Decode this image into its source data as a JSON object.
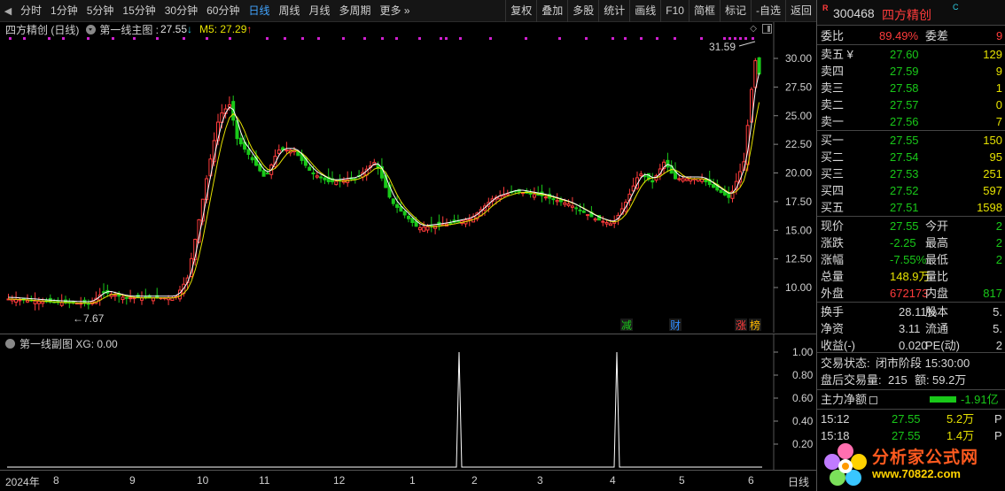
{
  "toolbar": {
    "periods": [
      "分时",
      "1分钟",
      "5分钟",
      "15分钟",
      "30分钟",
      "60分钟",
      "日线",
      "周线",
      "月线",
      "多周期",
      "更多"
    ],
    "active_period": "日线",
    "more_suffix": "»",
    "tools": [
      "复权",
      "叠加",
      "多股",
      "统计",
      "画线",
      "F10",
      "简框",
      "标记",
      "-自选",
      "返回"
    ]
  },
  "main_chart": {
    "stock_title": "四方精创 (日线)",
    "indicator_name": "第一线主图 : ",
    "indicator_value": "27.55",
    "down_arrow": "↓",
    "ma_label": "M5: 27.29",
    "up_arrow": "↑",
    "price_ticks": [
      "30.00",
      "27.50",
      "25.00",
      "22.50",
      "20.00",
      "17.50",
      "15.00",
      "12.50",
      "10.00"
    ],
    "high_label": "31.59",
    "low_label": "7.67",
    "event_tags": [
      {
        "text": "减",
        "color": "#19c819"
      },
      {
        "text": "财",
        "color": "#2f8cff"
      },
      {
        "text": "涨",
        "color": "#ff3b3b"
      },
      {
        "text": "榜",
        "color": "#ffb800"
      }
    ]
  },
  "sub_chart": {
    "title": "第一线副图",
    "value_label": "XG: 0.00",
    "y_ticks": [
      "1.00",
      "0.80",
      "0.60",
      "0.40",
      "0.20"
    ]
  },
  "time_axis": {
    "labels": [
      "2024年",
      "8",
      "9",
      "10",
      "11",
      "12",
      "1",
      "2",
      "3",
      "4",
      "5",
      "6"
    ],
    "period_button": "日线"
  },
  "quote": {
    "badge_r": "R",
    "code": "300468",
    "name": "四方精创",
    "badge_c": "C",
    "weibi_label": "委比",
    "weibi_value": "89.49%",
    "weicha_label": "委差",
    "weicha_value": "9",
    "asks": [
      {
        "label": "卖五 ¥",
        "price": "27.60",
        "vol": "129"
      },
      {
        "label": "卖四",
        "price": "27.59",
        "vol": "9"
      },
      {
        "label": "卖三",
        "price": "27.58",
        "vol": "1"
      },
      {
        "label": "卖二",
        "price": "27.57",
        "vol": "0"
      },
      {
        "label": "卖一",
        "price": "27.56",
        "vol": "7"
      }
    ],
    "bids": [
      {
        "label": "买一",
        "price": "27.55",
        "vol": "150"
      },
      {
        "label": "买二",
        "price": "27.54",
        "vol": "95"
      },
      {
        "label": "买三",
        "price": "27.53",
        "vol": "251"
      },
      {
        "label": "买四",
        "price": "27.52",
        "vol": "597"
      },
      {
        "label": "买五",
        "price": "27.51",
        "vol": "1598"
      }
    ],
    "stats": [
      {
        "l1": "现价",
        "v1": "27.55",
        "c1": "green",
        "l2": "今开",
        "v2": "2",
        "c2": "green"
      },
      {
        "l1": "涨跌",
        "v1": "-2.25",
        "c1": "green",
        "l2": "最高",
        "v2": "2",
        "c2": "green"
      },
      {
        "l1": "涨幅",
        "v1": "-7.55%",
        "c1": "green",
        "l2": "最低",
        "v2": "2",
        "c2": "green"
      },
      {
        "l1": "总量",
        "v1": "148.9万",
        "c1": "yellow",
        "l2": "量比",
        "v2": "",
        "c2": "white"
      },
      {
        "l1": "外盘",
        "v1": "672173",
        "c1": "red",
        "l2": "内盘",
        "v2": "817",
        "c2": "green"
      }
    ],
    "stats2": [
      {
        "l1": "换手",
        "v1": "28.11%",
        "l2": "股本",
        "v2": "5."
      },
      {
        "l1": "净资",
        "v1": "3.11",
        "l2": "流通",
        "v2": "5."
      },
      {
        "l1": "收益(-)",
        "v1": "0.020",
        "l2": "PE(动)",
        "v2": "2"
      }
    ],
    "trade_state_label": "交易状态:",
    "trade_state_value": "闭市阶段 15:30:00",
    "after_hours_label": "盘后交易量:",
    "after_hours_vol": "215",
    "after_hours_amt_label": "额:",
    "after_hours_amt": "59.2万",
    "main_flow_label": "主力净额",
    "main_flow_value": "-1.91亿",
    "ticks": [
      {
        "time": "15:12",
        "price": "27.55",
        "vol": "5.2万",
        "side": "P"
      },
      {
        "time": "15:18",
        "price": "27.55",
        "vol": "1.4万",
        "side": "P"
      }
    ]
  },
  "watermark": {
    "text": "分析家公式网",
    "url": "www.70822.com"
  },
  "colors": {
    "up": "#ff3b3b",
    "down": "#19c819",
    "ma5": "#e6e200",
    "indicator": "#ffffff",
    "marker": "#d020d0"
  }
}
